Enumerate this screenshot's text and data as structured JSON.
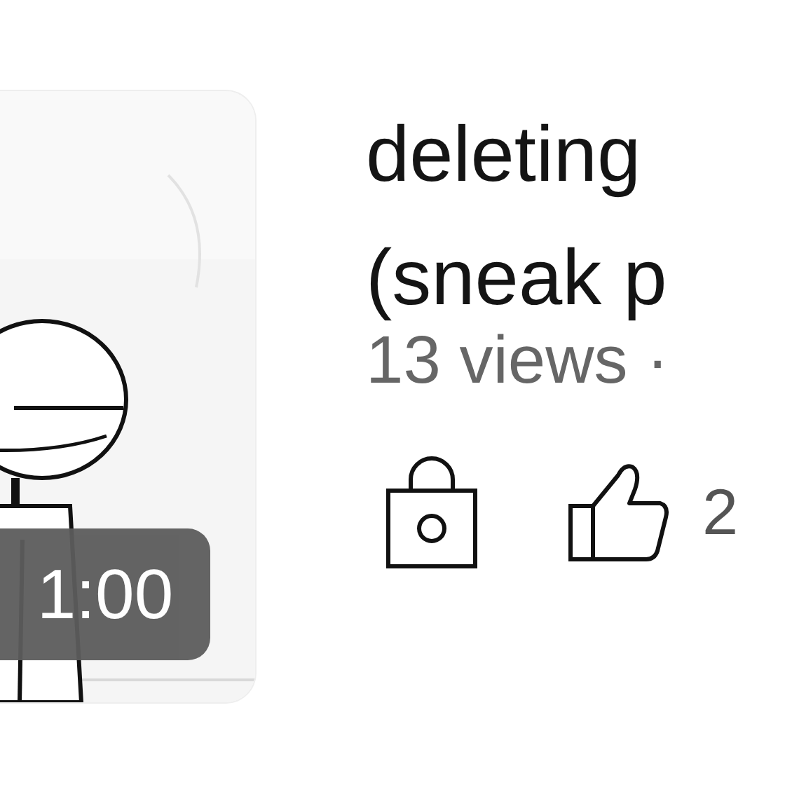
{
  "video": {
    "duration": "1:00",
    "title_lines": [
      "deleting",
      "(sneak p"
    ],
    "meta": "13 views ·",
    "locked": true,
    "likes": "2"
  }
}
